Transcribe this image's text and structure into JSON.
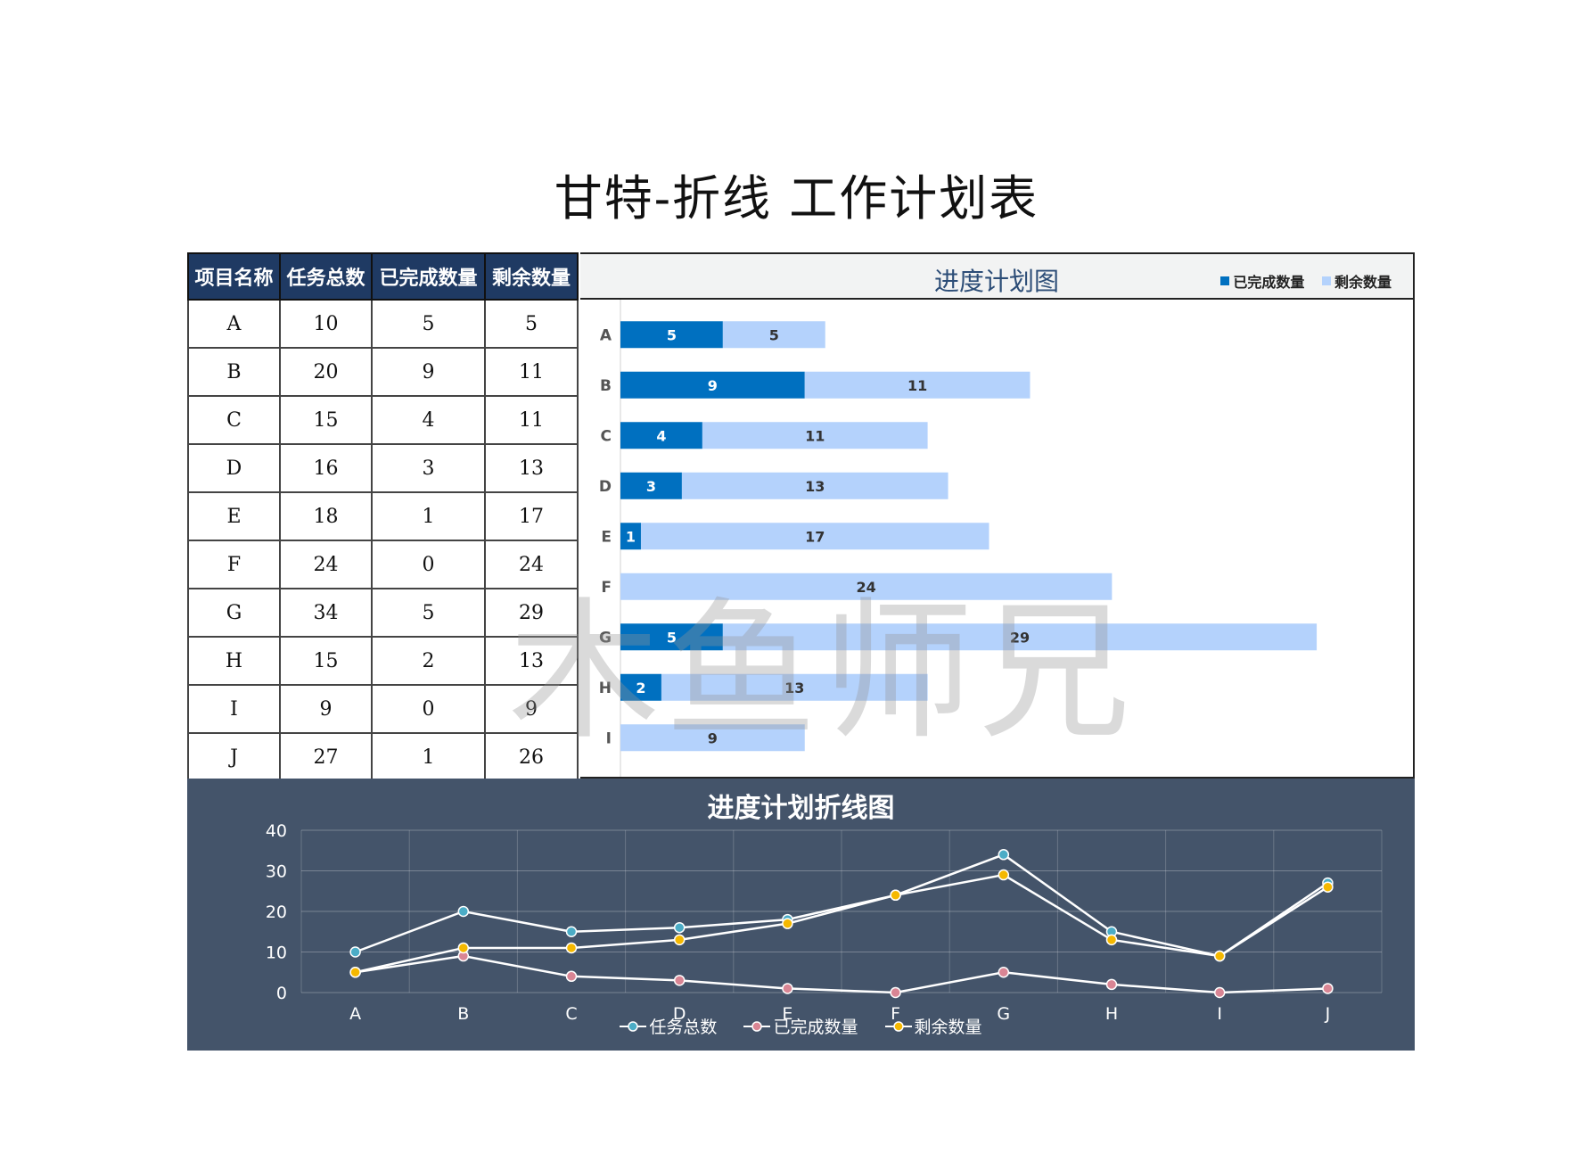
{
  "page": {
    "title": "甘特-折线  工作计划表",
    "watermark": "木鱼师兄"
  },
  "table": {
    "headers": [
      "项目名称",
      "任务总数",
      "已完成数量",
      "剩余数量"
    ],
    "rows": [
      [
        "A",
        "10",
        "5",
        "5"
      ],
      [
        "B",
        "20",
        "9",
        "11"
      ],
      [
        "C",
        "15",
        "4",
        "11"
      ],
      [
        "D",
        "16",
        "3",
        "13"
      ],
      [
        "E",
        "18",
        "1",
        "17"
      ],
      [
        "F",
        "24",
        "0",
        "24"
      ],
      [
        "G",
        "34",
        "5",
        "29"
      ],
      [
        "H",
        "15",
        "2",
        "13"
      ],
      [
        "I",
        "9",
        "0",
        "9"
      ],
      [
        "J",
        "27",
        "1",
        "26"
      ]
    ]
  },
  "colors": {
    "header_bg": "#1f3a63",
    "done": "#0070c0",
    "remaining": "#b4d2fc",
    "line_panel_bg": "#44546a",
    "total_marker": "#4bacc6",
    "done_marker": "#d98594",
    "remaining_marker": "#f5b800"
  },
  "chart_data": [
    {
      "type": "bar",
      "orientation": "horizontal",
      "stacked": true,
      "title": "进度计划图",
      "categories": [
        "A",
        "B",
        "C",
        "D",
        "E",
        "F",
        "G",
        "H",
        "I"
      ],
      "series": [
        {
          "name": "已完成数量",
          "values": [
            5,
            9,
            4,
            3,
            1,
            0,
            5,
            2,
            0
          ],
          "color": "#0070c0"
        },
        {
          "name": "剩余数量",
          "values": [
            5,
            11,
            11,
            13,
            17,
            24,
            29,
            13,
            9
          ],
          "color": "#b4d2fc"
        }
      ],
      "xlim": [
        0,
        37
      ],
      "data_labels": true,
      "legend": "top-right"
    },
    {
      "type": "line",
      "title": "进度计划折线图",
      "categories": [
        "A",
        "B",
        "C",
        "D",
        "E",
        "F",
        "G",
        "H",
        "I",
        "J"
      ],
      "series": [
        {
          "name": "任务总数",
          "values": [
            10,
            20,
            15,
            16,
            18,
            24,
            34,
            15,
            9,
            27
          ],
          "marker": "#4bacc6"
        },
        {
          "name": "已完成数量",
          "values": [
            5,
            9,
            4,
            3,
            1,
            0,
            5,
            2,
            0,
            1
          ],
          "marker": "#d98594"
        },
        {
          "name": "剩余数量",
          "values": [
            5,
            11,
            11,
            13,
            17,
            24,
            29,
            13,
            9,
            26
          ],
          "marker": "#f5b800"
        }
      ],
      "ylim": [
        0,
        40
      ],
      "yticks": [
        0,
        10,
        20,
        30,
        40
      ],
      "grid": true,
      "legend": "bottom"
    }
  ]
}
